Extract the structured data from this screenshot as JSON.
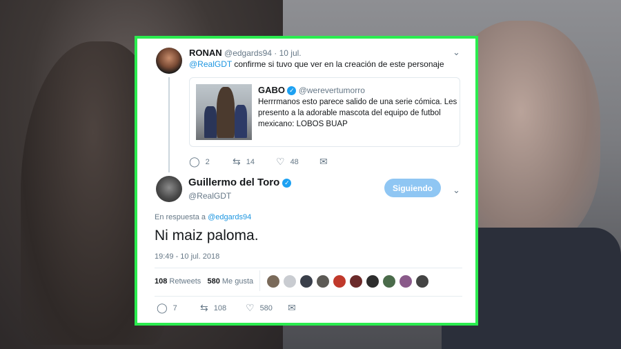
{
  "colors": {
    "accent": "#1da1f2",
    "border_highlight": "#2bec4f",
    "follow_button": "#8fc6f3"
  },
  "parent_tweet": {
    "display_name": "RONAN",
    "handle": "@edgards94",
    "separator": "·",
    "date": "10 jul.",
    "mention": "@RealGDT",
    "text": "confirme si tuvo que ver en la creación de este personaje",
    "quoted": {
      "display_name": "GABO",
      "handle": "@werevertumorro",
      "lines": [
        "Herrrmanos esto parece salido de una serie cómica. Les",
        "presento a la adorable mascota del equipo de futbol",
        "mexicano: LOBOS BUAP"
      ]
    },
    "actions": {
      "replies": "2",
      "retweets": "14",
      "likes": "48"
    }
  },
  "main_tweet": {
    "display_name": "Guillermo del Toro",
    "handle": "@RealGDT",
    "follow_label": "Siguiendo",
    "reply_prefix": "En respuesta a",
    "reply_to": "@edgards94",
    "text": "Ni maiz paloma.",
    "timestamp": "19:49 - 10 jul. 2018",
    "stats": {
      "retweets_count": "108",
      "retweets_label": "Retweets",
      "likes_count": "580",
      "likes_label": "Me gusta"
    },
    "likers": [
      "#7a6a5a",
      "#c9ccd1",
      "#3a3f4a",
      "#5c5a55",
      "#c0392b",
      "#6b2a2a",
      "#2d2d2d",
      "#4a6b4a",
      "#8a5a8a",
      "#444444"
    ],
    "actions": {
      "replies": "7",
      "retweets": "108",
      "likes": "580"
    }
  },
  "icons": {
    "reply": "reply-icon",
    "retweet": "retweet-icon",
    "like": "heart-icon",
    "dm": "envelope-icon",
    "chevron": "chevron-down-icon",
    "verified": "verified-badge-icon"
  }
}
